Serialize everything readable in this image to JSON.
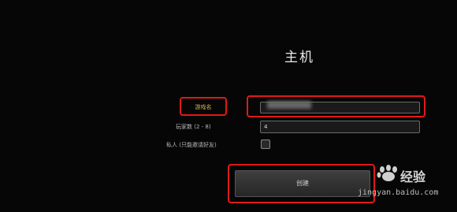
{
  "dialog": {
    "title": "主机",
    "labels": {
      "game_name": "游戏名",
      "player_count": "玩家数 (2 - 8)",
      "private": "私人 (只能邀请好友)"
    },
    "fields": {
      "game_name_value": "",
      "player_count_value": "4",
      "private_checked": false
    },
    "create_button": "创建"
  },
  "watermark": {
    "brand": "经验",
    "url": "jingyan.baidu.com"
  },
  "colors": {
    "highlight": "#e11919",
    "label_highlight": "#d9b84a",
    "background": "#060606"
  }
}
